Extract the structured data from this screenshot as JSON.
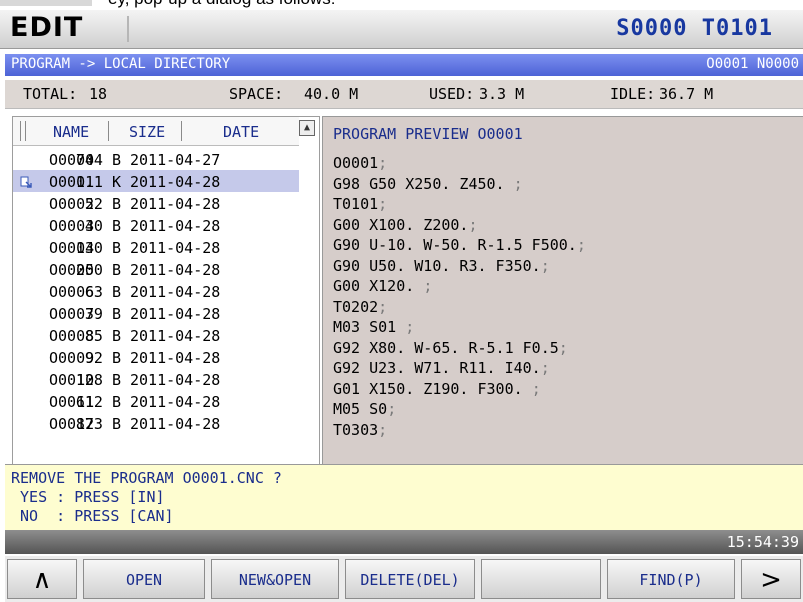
{
  "caption": "ey, pop-up a dialog as follows:",
  "mode": {
    "label": "EDIT",
    "status": "S0000 T0101"
  },
  "title_bar": {
    "path": "PROGRAM -> LOCAL DIRECTORY",
    "program": "O0001 N0000"
  },
  "info": {
    "total_label": "TOTAL:",
    "total_value": "18",
    "space_label": "SPACE:",
    "space_value": "40.0 M",
    "used_label": "USED:",
    "used_value": "3.3 M",
    "idle_label": "IDLE:",
    "idle_value": "36.7 M"
  },
  "file_list": {
    "headers": {
      "name": "NAME",
      "size": "SIZE",
      "date": "DATE"
    },
    "rows": [
      {
        "name": "O0000",
        "size": "744 B",
        "date": "2011-04-27",
        "selected": false
      },
      {
        "name": "O0001",
        "size": "1.1 K",
        "date": "2011-04-28",
        "selected": true
      },
      {
        "name": "O0002",
        "size": "52 B",
        "date": "2011-04-28",
        "selected": false
      },
      {
        "name": "O0003",
        "size": "40 B",
        "date": "2011-04-28",
        "selected": false
      },
      {
        "name": "O0004",
        "size": "130 B",
        "date": "2011-04-28",
        "selected": false
      },
      {
        "name": "O0005",
        "size": "200 B",
        "date": "2011-04-28",
        "selected": false
      },
      {
        "name": "O0006",
        "size": "63 B",
        "date": "2011-04-28",
        "selected": false
      },
      {
        "name": "O0007",
        "size": "39 B",
        "date": "2011-04-28",
        "selected": false
      },
      {
        "name": "O0008",
        "size": "85 B",
        "date": "2011-04-28",
        "selected": false
      },
      {
        "name": "O0009",
        "size": "92 B",
        "date": "2011-04-28",
        "selected": false
      },
      {
        "name": "O0010",
        "size": "128 B",
        "date": "2011-04-28",
        "selected": false
      },
      {
        "name": "O0011",
        "size": "612 B",
        "date": "2011-04-28",
        "selected": false
      },
      {
        "name": "O0012",
        "size": "873 B",
        "date": "2011-04-28",
        "selected": false
      }
    ]
  },
  "preview": {
    "title": "PROGRAM PREVIEW O0001",
    "lines": [
      "O0001",
      "G98 G50 X250. Z450. ",
      "T0101",
      "G00 X100. Z200.",
      "G90 U-10. W-50. R-1.5 F500.",
      "G90 U50. W10. R3. F350.",
      "G00 X120. ",
      "T0202",
      "M03 S01 ",
      "G92 X80. W-65. R-5.1 F0.5",
      "G92 U23. W71. R11. I40.",
      "G01 X150. Z190. F300. ",
      "M05 S0",
      "T0303"
    ],
    "terminator": ";"
  },
  "message": {
    "question": "REMOVE THE PROGRAM O0001.CNC ?",
    "yes": " YES : PRESS [IN]",
    "no": " NO  : PRESS [CAN]"
  },
  "clock": "15:54:39",
  "softkeys": {
    "prev": "∧",
    "open": "OPEN",
    "new_open": "NEW&OPEN",
    "delete": "DELETE(DEL)",
    "empty": "",
    "find": "FIND(P)",
    "next": ">"
  }
}
